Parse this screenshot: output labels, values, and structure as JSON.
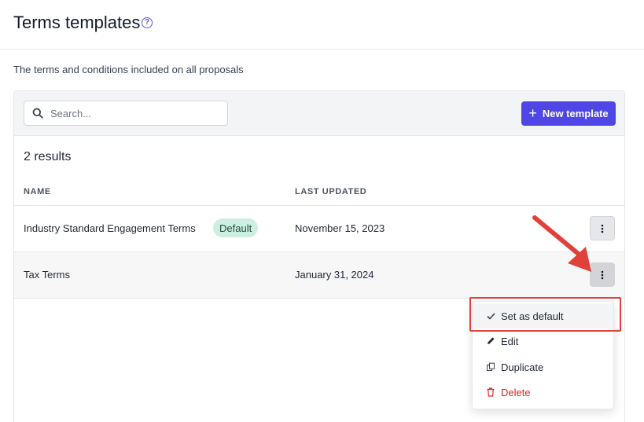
{
  "header": {
    "title": "Terms templates",
    "help_glyph": "?"
  },
  "subtitle": "The terms and conditions included on all proposals",
  "toolbar": {
    "search_placeholder": "Search...",
    "new_template_label": "New template",
    "new_template_icon": "+"
  },
  "results_label": "2 results",
  "table": {
    "columns": [
      "NAME",
      "LAST UPDATED"
    ],
    "rows": [
      {
        "name": "Industry Standard Engagement Terms",
        "badge": "Default",
        "updated": "November 15, 2023"
      },
      {
        "name": "Tax Terms",
        "badge": "",
        "updated": "January 31, 2024"
      }
    ]
  },
  "menu": {
    "items": [
      {
        "label": "Set as default",
        "icon": "check-icon"
      },
      {
        "label": "Edit",
        "icon": "pencil-icon"
      },
      {
        "label": "Duplicate",
        "icon": "copy-icon"
      },
      {
        "label": "Delete",
        "icon": "trash-icon"
      }
    ]
  },
  "colors": {
    "accent": "#4f46e5",
    "badge_bg": "#cdeee0",
    "danger": "#dc2626",
    "annotation": "#e0413a"
  }
}
